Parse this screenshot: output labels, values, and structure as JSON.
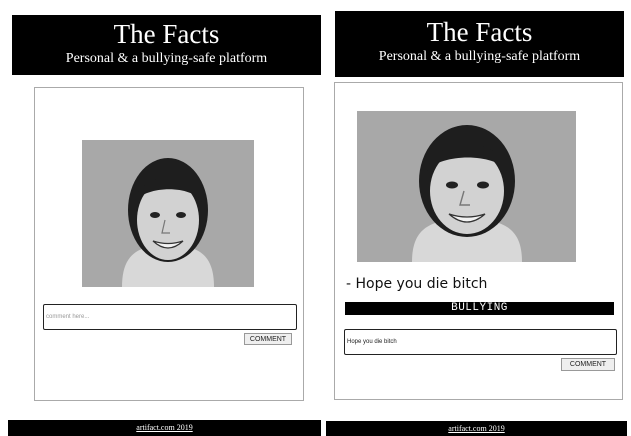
{
  "left": {
    "header": {
      "title": "The Facts",
      "subtitle": "Personal & a bullying-safe platform"
    },
    "comment_input": {
      "placeholder": "comment here..."
    },
    "comment_button": "COMMENT",
    "footer": "artifact.com 2019"
  },
  "right": {
    "header": {
      "title": "The Facts",
      "subtitle": "Personal & a bullying-safe platform"
    },
    "posted_comment": "- Hope you die bitch",
    "badge": "BULLYING",
    "comment_input": {
      "value": "Hope you die bitch"
    },
    "comment_button": "COMMENT",
    "footer": "artifact.com 2019"
  },
  "colors": {
    "header_bg": "#000000",
    "badge_bg": "#000000",
    "page_bg": "#ffffff"
  }
}
